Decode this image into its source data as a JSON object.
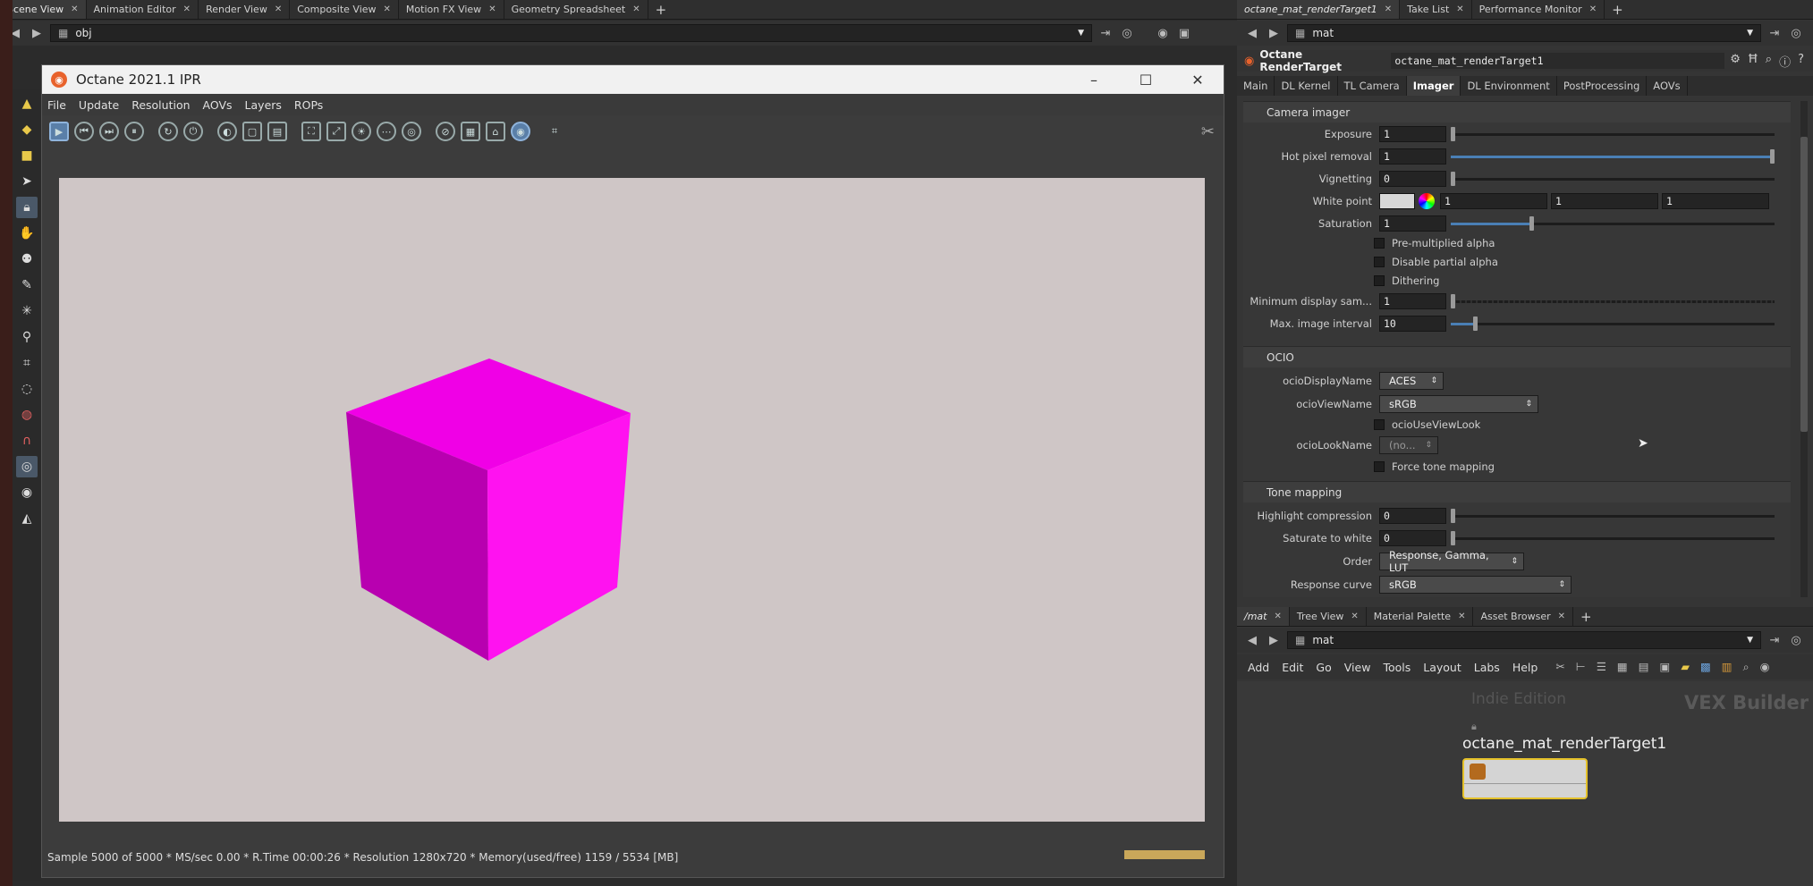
{
  "top_tabs": [
    "Scene View",
    "Animation Editor",
    "Render View",
    "Composite View",
    "Motion FX View",
    "Geometry Spreadsheet"
  ],
  "path": "obj",
  "octane_window": {
    "title": "Octane 2021.1 IPR",
    "menu": [
      "File",
      "Update",
      "Resolution",
      "AOVs",
      "Layers",
      "ROPs"
    ],
    "status": "Sample 5000 of 5000 * MS/sec 0.00 * R.Time 00:00:26 * Resolution 1280x720 * Memory(used/free) 1159 / 5534 [MB]"
  },
  "param_panel": {
    "tabs": [
      "octane_mat_renderTarget1",
      "Take List",
      "Performance Monitor"
    ],
    "path": "mat",
    "node_type": "Octane RenderTarget",
    "node_name": "octane_mat_renderTarget1",
    "param_tabs": [
      "Main",
      "DL Kernel",
      "TL Camera",
      "Imager",
      "DL Environment",
      "PostProcessing",
      "AOVs"
    ],
    "sections": {
      "camera_imager": "Camera imager",
      "ocio": "OCIO",
      "tone_mapping": "Tone mapping"
    },
    "params": {
      "exposure": {
        "label": "Exposure",
        "value": "1"
      },
      "hot_pixel": {
        "label": "Hot pixel removal",
        "value": "1"
      },
      "vignetting": {
        "label": "Vignetting",
        "value": "0"
      },
      "white_point": {
        "label": "White point",
        "r": "1",
        "g": "1",
        "b": "1"
      },
      "saturation": {
        "label": "Saturation",
        "value": "1"
      },
      "premult": "Pre-multiplied alpha",
      "partial_alpha": "Disable partial alpha",
      "dithering": "Dithering",
      "min_display": {
        "label": "Minimum display sam...",
        "value": "1"
      },
      "max_interval": {
        "label": "Max. image interval",
        "value": "10"
      },
      "ocio_display": {
        "label": "ocioDisplayName",
        "value": "ACES"
      },
      "ocio_view": {
        "label": "ocioViewName",
        "value": "sRGB"
      },
      "ocio_use_look": "ocioUseViewLook",
      "ocio_look": {
        "label": "ocioLookName",
        "value": "(no..."
      },
      "force_tone": "Force tone mapping",
      "highlight": {
        "label": "Highlight compression",
        "value": "0"
      },
      "sat_white": {
        "label": "Saturate to white",
        "value": "0"
      },
      "order": {
        "label": "Order",
        "value": "Response, Gamma, LUT"
      },
      "response": {
        "label": "Response curve",
        "value": "sRGB"
      }
    }
  },
  "network": {
    "tabs": [
      "/mat",
      "Tree View",
      "Material Palette",
      "Asset Browser"
    ],
    "path": "mat",
    "menu": [
      "Add",
      "Edit",
      "Go",
      "View",
      "Tools",
      "Layout",
      "Labs",
      "Help"
    ],
    "watermark_left": "Indie Edition",
    "watermark_right": "VEX Builder",
    "node_label": "octane_mat_renderTarget1"
  },
  "colors": {
    "cube": "#ff10ee",
    "background": "#cfc6c6",
    "accent": "#4a7fb5"
  }
}
